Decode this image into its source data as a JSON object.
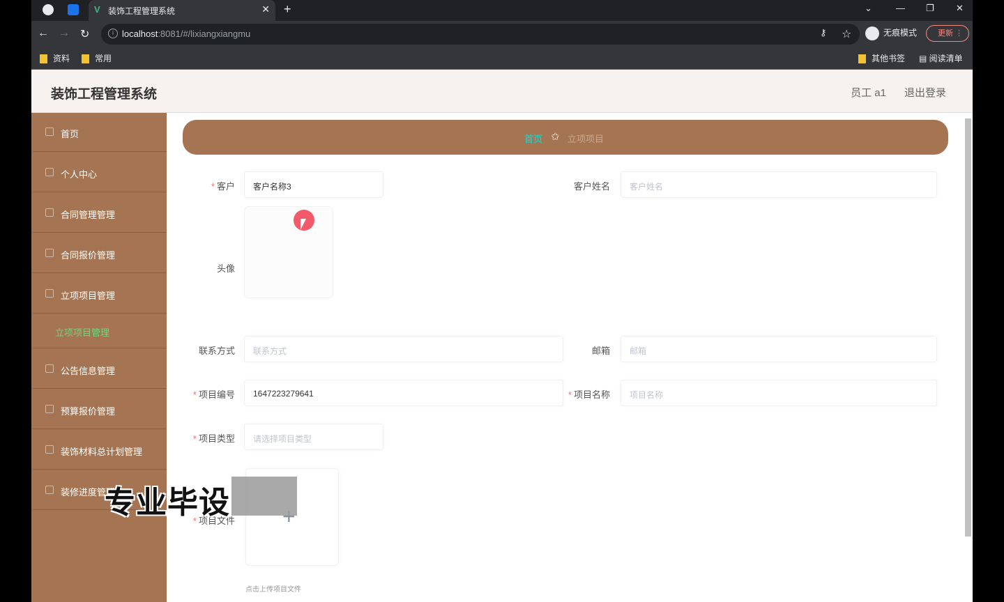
{
  "browser": {
    "tab_title": "装饰工程管理系统",
    "tab_favicon": "V",
    "url_host": "localhost",
    "url_rest": ":8081/#/lixiangxiangmu",
    "incognito_label": "无痕模式",
    "update_label": "更新",
    "bookmarks": [
      "资料",
      "常用"
    ],
    "bookmarks_right": [
      "其他书签",
      "阅读清单"
    ]
  },
  "header": {
    "title": "装饰工程管理系统",
    "user": "员工 a1",
    "logout": "退出登录"
  },
  "sidebar": {
    "items": [
      {
        "label": "首页"
      },
      {
        "label": "个人中心"
      },
      {
        "label": "合同管理管理"
      },
      {
        "label": "合同报价管理"
      },
      {
        "label": "立项项目管理"
      },
      {
        "label": "公告信息管理"
      },
      {
        "label": "预算报价管理"
      },
      {
        "label": "装饰材料总计划管理"
      },
      {
        "label": "装修进度管理"
      }
    ],
    "active_sub": "立项项目管理"
  },
  "breadcrumb": {
    "home": "首页",
    "current": "立项项目"
  },
  "form": {
    "customer_label": "客户",
    "customer_value": "客户名称3",
    "customer_name_label": "客户姓名",
    "customer_name_placeholder": "客户姓名",
    "avatar_label": "头像",
    "contact_label": "联系方式",
    "contact_placeholder": "联系方式",
    "email_label": "邮箱",
    "email_placeholder": "邮箱",
    "project_no_label": "项目编号",
    "project_no_value": "1647223279641",
    "project_name_label": "项目名称",
    "project_name_placeholder": "项目名称",
    "project_type_label": "项目类型",
    "project_type_placeholder": "请选择项目类型",
    "project_file_label": "项目文件",
    "upload_plus": "+",
    "upload_tip": "点击上传项目文件"
  },
  "watermark": "专业毕设"
}
